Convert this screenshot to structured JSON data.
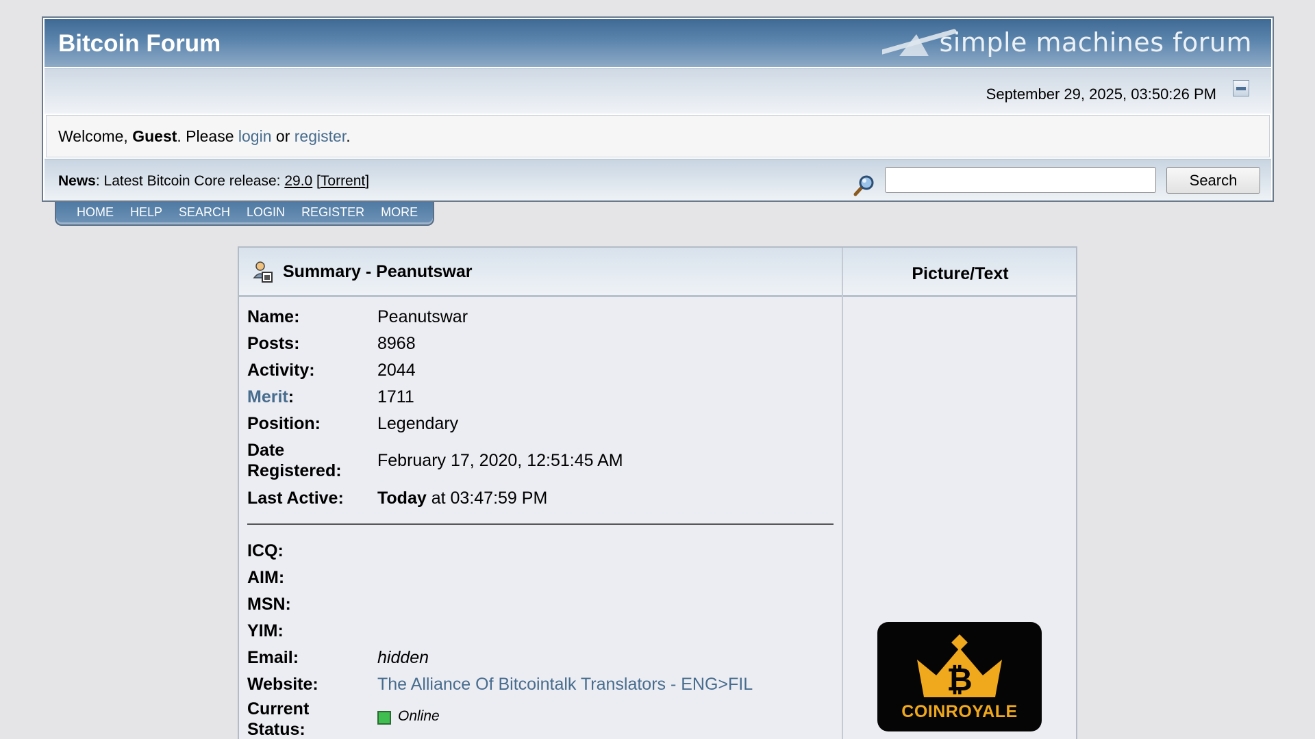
{
  "header": {
    "title": "Bitcoin Forum",
    "logo_text": "simple machines forum",
    "datetime": "September 29, 2025, 03:50:26 PM",
    "collapse_icon": "collapse-icon"
  },
  "welcome": {
    "prefix": "Welcome, ",
    "user": "Guest",
    "please": ". Please ",
    "login": "login",
    "or": " or ",
    "register": "register",
    "suffix": "."
  },
  "news": {
    "label": "News",
    "text": ": Latest Bitcoin Core release: ",
    "version": "29.0",
    "open_bracket": " [",
    "torrent": "Torrent",
    "close_bracket": "]"
  },
  "search": {
    "placeholder": "",
    "button": "Search",
    "icon": "magnifier-icon"
  },
  "nav": {
    "items": [
      "HOME",
      "HELP",
      "SEARCH",
      "LOGIN",
      "REGISTER",
      "MORE"
    ]
  },
  "profile": {
    "summary_title": "Summary - Peanutswar",
    "picture_title": "Picture/Text",
    "fields": {
      "name": {
        "label": "Name:",
        "value": "Peanutswar"
      },
      "posts": {
        "label": "Posts:",
        "value": "8968"
      },
      "activity": {
        "label": "Activity:",
        "value": "2044"
      },
      "merit": {
        "label": "Merit",
        "colon": ":",
        "value": "1711"
      },
      "position": {
        "label": "Position:",
        "value": "Legendary"
      },
      "date_registered": {
        "label_1": "Date",
        "label_2": "Registered:",
        "value": "February 17, 2020, 12:51:45 AM"
      },
      "last_active": {
        "label": "Last Active:",
        "value_bold": "Today",
        "value_rest": " at 03:47:59 PM"
      },
      "icq": {
        "label": "ICQ:"
      },
      "aim": {
        "label": "AIM:"
      },
      "msn": {
        "label": "MSN:"
      },
      "yim": {
        "label": "YIM:"
      },
      "email": {
        "label": "Email:",
        "value": "hidden"
      },
      "website": {
        "label": "Website:",
        "value": "The Alliance Of Bitcointalk Translators - ENG>FIL"
      },
      "status": {
        "label_1": "Current",
        "label_2": "Status:",
        "value": "Online"
      }
    },
    "avatar": {
      "brand": "COINROYALE",
      "colors": {
        "background": "#050505",
        "accent": "#f0a81c"
      }
    }
  },
  "colors": {
    "link": "#476c8e",
    "title_bar": "#3f6a94",
    "page_bg": "#e5e5e8"
  }
}
